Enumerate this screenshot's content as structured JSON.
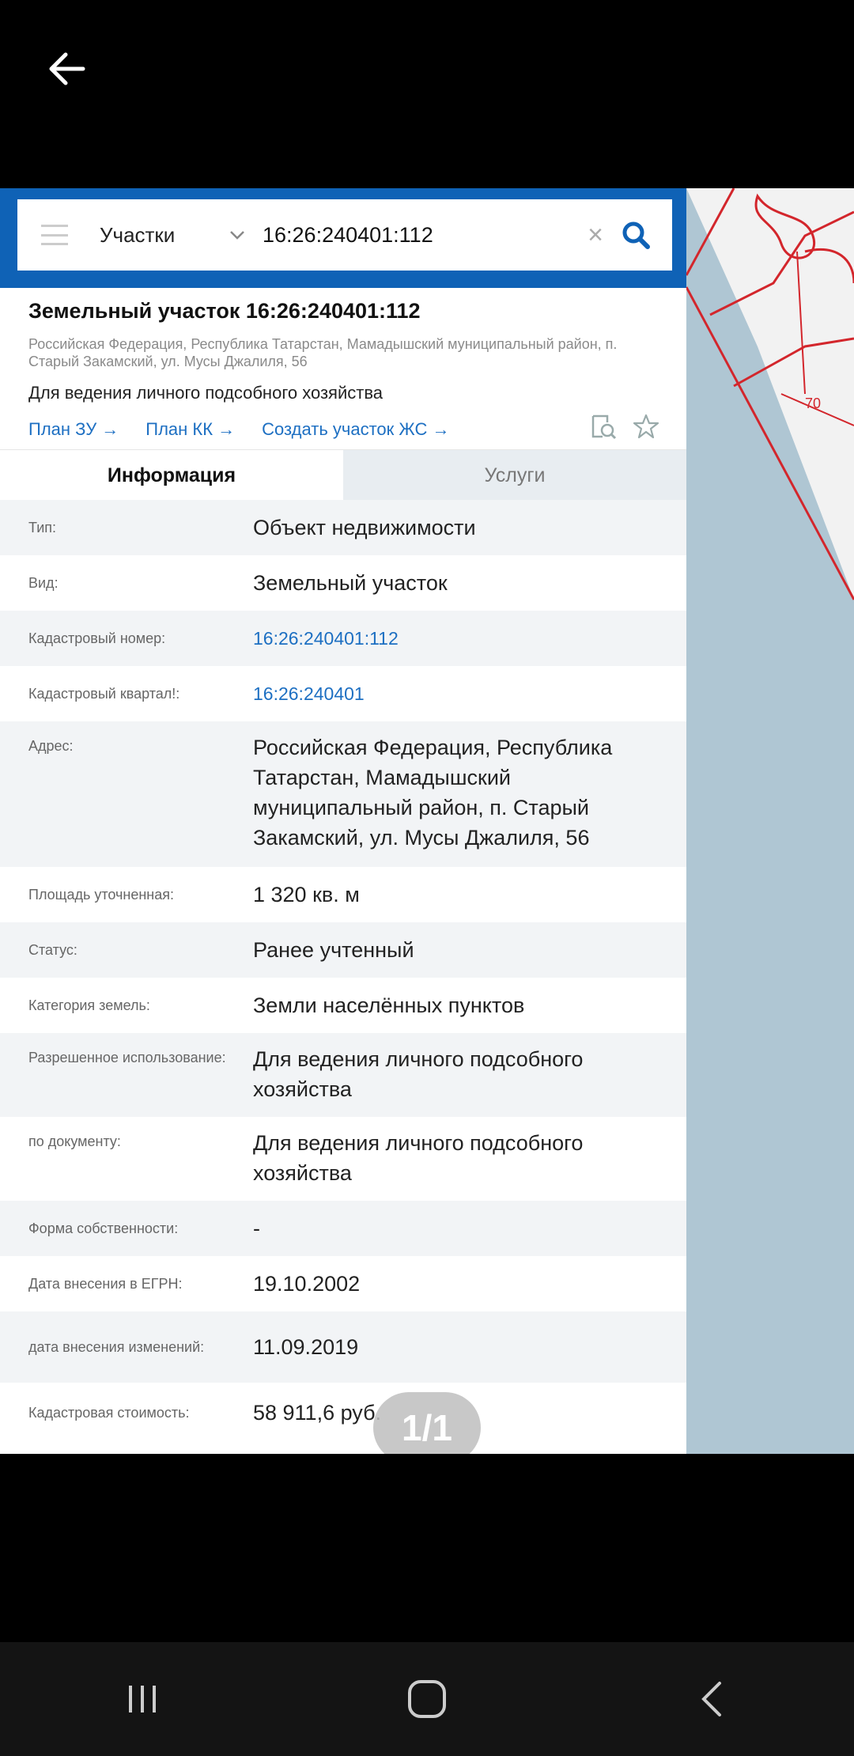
{
  "search": {
    "type_label": "Участки",
    "query": "16:26:240401:112"
  },
  "object": {
    "title": "Земельный участок 16:26:240401:112",
    "address": "Российская Федерация, Республика Татарстан, Мамадышский муниципальный район, п. Старый Закамский, ул. Мусы Джалиля, 56",
    "purpose": "Для ведения личного подсобного хозяйства"
  },
  "links": {
    "plan_zu": "План ЗУ →",
    "plan_kk": "План КК →",
    "create_zhs": "Создать участок ЖС →"
  },
  "tabs": {
    "info": "Информация",
    "services": "Услуги"
  },
  "rows": [
    {
      "label": "Тип:",
      "value": "Объект недвижимости"
    },
    {
      "label": "Вид:",
      "value": "Земельный участок"
    },
    {
      "label": "Кадастровый номер:",
      "value": "16:26:240401:112"
    },
    {
      "label": "Кадастровый квартал!:",
      "value": "16:26:240401"
    },
    {
      "label": "Адрес:",
      "value": "Российская Федерация, Республика Татарстан, Мамадышский муниципальный район, п. Старый Закамский, ул. Мусы Джалиля, 56"
    },
    {
      "label": "Площадь уточненная:",
      "value": "1 320 кв. м"
    },
    {
      "label": "Статус:",
      "value": "Ранее учтенный"
    },
    {
      "label": "Категория земель:",
      "value": "Земли населённых пунктов"
    },
    {
      "label": "Разрешенное использование:",
      "value": "Для ведения личного подсобного хозяйства"
    },
    {
      "label": "по документу:",
      "value": "Для ведения личного подсобного хозяйства"
    },
    {
      "label": "Форма собственности:",
      "value": "-"
    },
    {
      "label": "Дата внесения в ЕГРН:",
      "value": "19.10.2002"
    },
    {
      "label": "дата внесения изменений:",
      "value": "11.09.2019"
    },
    {
      "label": "Кадастровая стоимость:",
      "value": "58 911,6 руб."
    }
  ],
  "pager": "1/1",
  "map": {
    "parcel_label": "70"
  },
  "colors": {
    "brand_blue": "#0f62b6",
    "link_blue": "#1d6fc2",
    "parcel_red": "#d3262c",
    "map_water": "#afc6d3"
  }
}
